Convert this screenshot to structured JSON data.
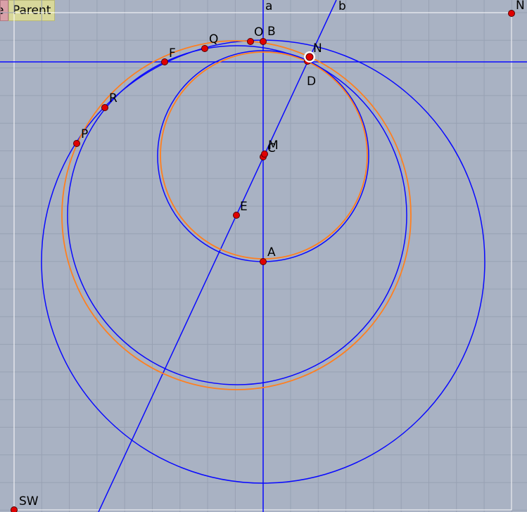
{
  "toolbar": {
    "partial_button_label": "e",
    "parent_button_label": "Parent"
  },
  "colors": {
    "background": "#a9b2c3",
    "grid": "#98a1b3",
    "frame": "#ffffff",
    "blue": "#0a0aff",
    "orange": "#ff7f1f",
    "point_fill": "#e00000",
    "point_stroke": "#550000"
  },
  "lines": [
    {
      "name": "a",
      "label": "a"
    },
    {
      "name": "b",
      "label": "b"
    }
  ],
  "points": [
    {
      "name": "A",
      "label": "A"
    },
    {
      "name": "B",
      "label": "B"
    },
    {
      "name": "C",
      "label": "C"
    },
    {
      "name": "D",
      "label": "D"
    },
    {
      "name": "E",
      "label": "E"
    },
    {
      "name": "F",
      "label": "F"
    },
    {
      "name": "M",
      "label": "M"
    },
    {
      "name": "N",
      "label": "N"
    },
    {
      "name": "O",
      "label": "O"
    },
    {
      "name": "P",
      "label": "P"
    },
    {
      "name": "Q",
      "label": "Q"
    },
    {
      "name": "R",
      "label": "R"
    },
    {
      "name": "SW",
      "label": "SW"
    },
    {
      "name": "NE",
      "label": "N"
    }
  ]
}
